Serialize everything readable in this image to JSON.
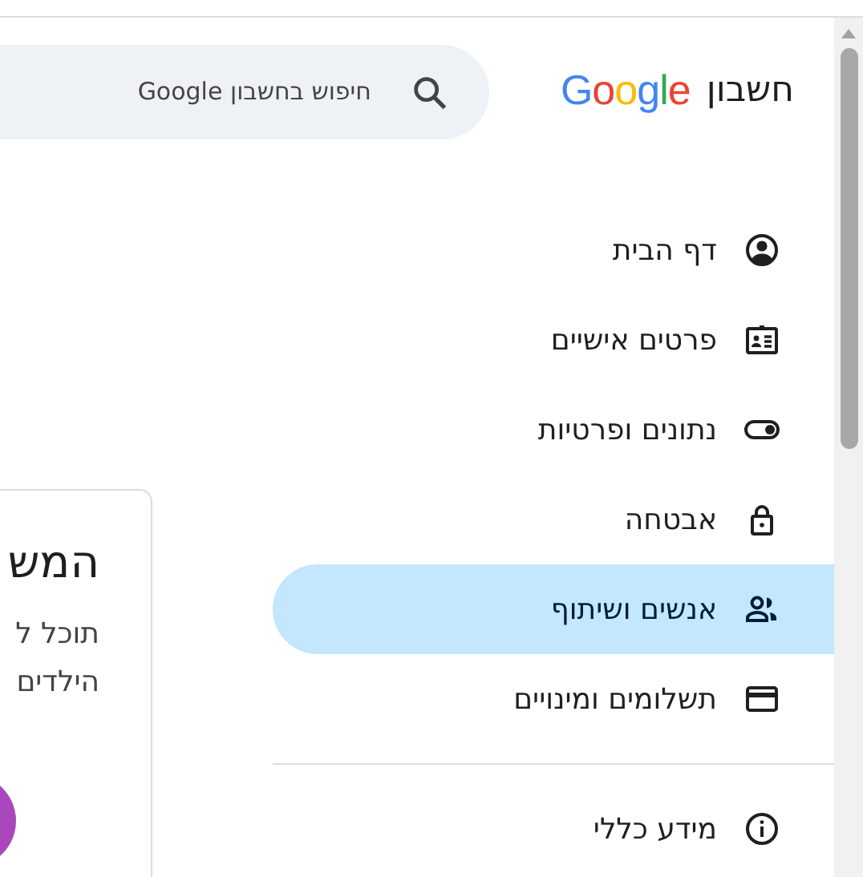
{
  "header": {
    "product": "חשבון",
    "logo": "Google",
    "search": {
      "placeholder": "חיפוש בחשבון Google"
    }
  },
  "nav": {
    "items": [
      {
        "label": "דף הבית",
        "kind": "home",
        "selected": false
      },
      {
        "label": "פרטים אישיים",
        "kind": "personal-info",
        "selected": false
      },
      {
        "label": "נתונים ופרטיות",
        "kind": "data-privacy",
        "selected": false
      },
      {
        "label": "אבטחה",
        "kind": "security",
        "selected": false
      },
      {
        "label": "אנשים ושיתוף",
        "kind": "people",
        "selected": true
      },
      {
        "label": "תשלומים ומינויים",
        "kind": "payments",
        "selected": false
      }
    ],
    "secondary_items": [
      {
        "label": "מידע כללי",
        "kind": "about",
        "selected": false
      }
    ]
  },
  "card": {
    "title": "המש",
    "lines": [
      "תוכל ל",
      "הילדים"
    ]
  }
}
